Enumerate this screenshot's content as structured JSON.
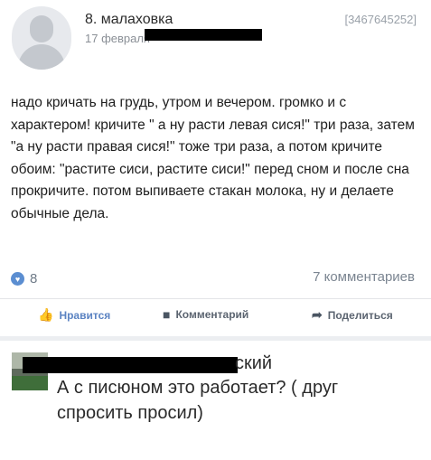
{
  "post": {
    "author": "8. малаховка",
    "post_id": "[3467645252]",
    "date_visible": "17 февраля",
    "text": "надо кричать на грудь, утром и вечером. громко и с характером! кричите \" а ну расти левая сися!\" три раза, затем \"а ну расти правая сися!\" тоже три раза, а потом кричите обоим: \"растите сиси, растите сиси!\" перед сном и после сна прокричите. потом выпиваете стакан молока, ну и делаете обычные дела.",
    "likes_count": "8",
    "comments_count": "7 комментариев",
    "actions": {
      "like": "Нравится",
      "comment": "Комментарий",
      "share": "Поделиться"
    },
    "icons": {
      "like_count_icon": "heart-icon",
      "like": "thumbs-up-icon",
      "comment": "speech-bubble-icon",
      "share": "share-arrow-icon"
    }
  },
  "comment": {
    "author_visible": "ский",
    "text": "А с писюном это работает? ( друг спросить просил)"
  },
  "colors": {
    "accent": "#5b8ed1",
    "muted_text": "#8a8f96",
    "separator": "#eceef1"
  }
}
